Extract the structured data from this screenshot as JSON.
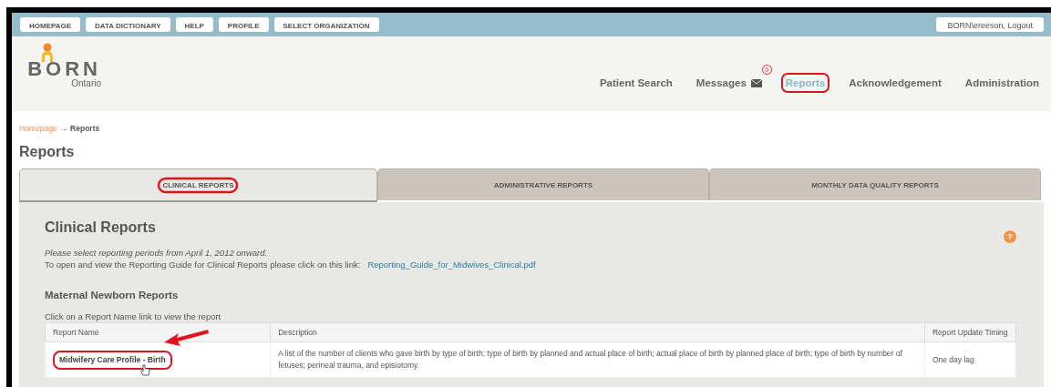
{
  "top_bar": {
    "buttons": [
      "HOMEPAGE",
      "DATA DICTIONARY",
      "HELP",
      "PROFILE",
      "SELECT ORGANIZATION"
    ],
    "user": "BORN\\ereeson, Logout"
  },
  "logo": {
    "word": "BORN",
    "subtitle": "Ontario"
  },
  "nav": [
    {
      "label": "Patient Search",
      "selected": false,
      "highlighted": false
    },
    {
      "label": "Messages",
      "selected": false,
      "highlighted": false,
      "badge": "0"
    },
    {
      "label": "Reports",
      "selected": true,
      "highlighted": true
    },
    {
      "label": "Acknowledgement",
      "selected": false,
      "highlighted": false
    },
    {
      "label": "Administration",
      "selected": false,
      "highlighted": false
    }
  ],
  "breadcrumb": {
    "link": "Homepage",
    "separator": "→",
    "current": "Reports"
  },
  "page_title": "Reports",
  "tabs": [
    {
      "label": "CLINICAL REPORTS",
      "selected": true,
      "highlighted": true
    },
    {
      "label": "ADMINISTRATIVE REPORTS",
      "selected": false,
      "highlighted": false
    },
    {
      "label": "MONTHLY DATA QUALITY REPORTS",
      "selected": false,
      "highlighted": false
    }
  ],
  "panel": {
    "title": "Clinical Reports",
    "note": "Please select reporting periods from April 1, 2012 onward.",
    "guide_text": "To open and view the Reporting Guide for Clinical Reports please click on this link:",
    "guide_link": "Reporting_Guide_for_Midwives_Clinical.pdf",
    "help": "?",
    "section": "Maternal Newborn Reports",
    "instruction": "Click on a Report Name link to view the report"
  },
  "table": {
    "columns": [
      "Report Name",
      "Description",
      "Report Update Timing"
    ],
    "rows": [
      {
        "name": "Midwifery Care Profile - Birth",
        "description": "A list of the number of clients who gave birth by type of birth; type of birth by planned and actual place of birth; actual place of birth by planned place of birth; type of birth by number of fetuses; perineal trauma, and episiotomy.",
        "timing": "One day lag",
        "highlighted": true,
        "arrow": true
      }
    ]
  }
}
